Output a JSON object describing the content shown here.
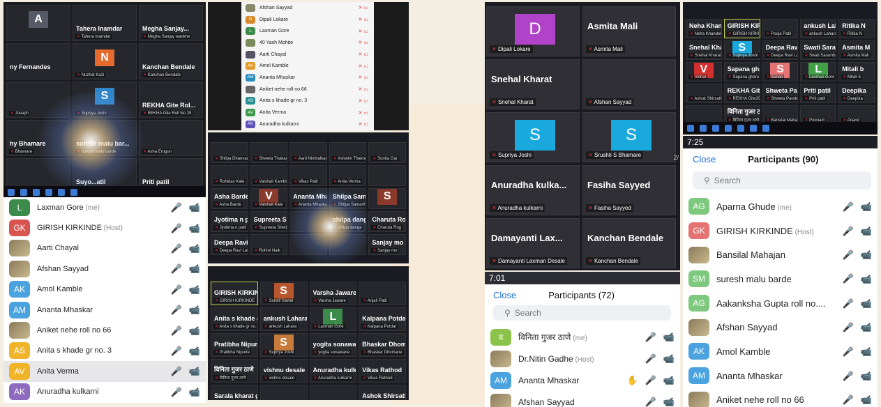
{
  "collage": {
    "shot1": {
      "tiles": [
        {
          "name": "",
          "sub": "",
          "avatar": "A",
          "color": "#555a66"
        },
        {
          "name": "Tahera Inamdar",
          "sub": "Tahera Inamdar"
        },
        {
          "name": "Megha Sanjay...",
          "sub": "Megha Sanjay wankhe"
        },
        {
          "name": "ny Fernandes",
          "sub": ""
        },
        {
          "name": "",
          "sub": "Nuzhat Kazi",
          "avatar": "N",
          "color": "#e46a2e"
        },
        {
          "name": "Kanchan Bendale",
          "sub": "Kanchan Bendale"
        },
        {
          "name": "",
          "sub": "Joseph"
        },
        {
          "name": "",
          "sub": "Supriya Joshi",
          "avatar": "S",
          "color": "#2f86c8"
        },
        {
          "name": "REKHA Gite Rol...",
          "sub": "REKHA Gite Roll No 29"
        },
        {
          "name": "hy Bhamare",
          "sub": "Bhamare"
        },
        {
          "name": "suresh malu bar...",
          "sub": "suresh malu barde"
        },
        {
          "name": "",
          "sub": "Asha Erogun"
        },
        {
          "name": "",
          "sub": "Mohite"
        },
        {
          "name": "Suyo...atil",
          "sub": "Suyog patil"
        },
        {
          "name": "Priti patil",
          "sub": "Priti patil"
        }
      ]
    },
    "shot2": {
      "rows": [
        {
          "name": "Afshan Sayyad",
          "avatar": "",
          "color": "#8a8a6a"
        },
        {
          "name": "Dipali Lokare",
          "avatar": "D",
          "color": "#d58a2a"
        },
        {
          "name": "Laxman Gore",
          "avatar": "L",
          "color": "#3d8b4a"
        },
        {
          "name": "40 Yash Mohite",
          "avatar": "",
          "color": "#7a8a5a"
        },
        {
          "name": "Aarti Chayal",
          "avatar": "",
          "color": "#556"
        },
        {
          "name": "Amol Kamble",
          "avatar": "AK",
          "color": "#e39a25"
        },
        {
          "name": "Ananta Mhaskar",
          "avatar": "AM",
          "color": "#2a8fc0"
        },
        {
          "name": "Aniket nehe roll no 66",
          "avatar": "",
          "color": "#666"
        },
        {
          "name": "Anita s khade gr no. 3",
          "avatar": "AS",
          "color": "#2a8f8f"
        },
        {
          "name": "Anita Verma",
          "avatar": "AV",
          "color": "#3b9b4a"
        },
        {
          "name": "Anuradha kulkarni",
          "avatar": "AK",
          "color": "#5b4fb8"
        }
      ]
    },
    "shot3": {
      "tiles": [
        {
          "name": "",
          "sub": "Shilpa Dhanvade"
        },
        {
          "name": "",
          "sub": "Shweta Thakare"
        },
        {
          "name": "",
          "sub": "Aarti Nimbalkar"
        },
        {
          "name": "",
          "sub": "Ashwini Thakre"
        },
        {
          "name": "",
          "sub": "Sunita Gar"
        },
        {
          "name": "",
          "sub": "Rohidas Kale"
        },
        {
          "name": "",
          "sub": "Vaishali Kamble"
        },
        {
          "name": "",
          "sub": "Vikas Patil"
        },
        {
          "name": "",
          "sub": "Anita Verma"
        },
        {
          "name": "",
          "sub": ""
        },
        {
          "name": "Asha Barde",
          "sub": "Asha Barde"
        },
        {
          "name": "",
          "sub": "Vaishali Kale",
          "avatar": "V",
          "color": "#8a3a2a"
        },
        {
          "name": "Ananta Mhaskar",
          "sub": "Ananta Mhaskar"
        },
        {
          "name": "Shilpa Samarth",
          "sub": "Shilpa Samarth"
        },
        {
          "name": "",
          "sub": "",
          "avatar": "S",
          "color": "#8a3a2a"
        },
        {
          "name": "Jyotima n patil",
          "sub": "Jyotima n patil"
        },
        {
          "name": "Supreeta Shetty",
          "sub": "Supreeta Shetty"
        },
        {
          "name": "",
          "sub": ""
        },
        {
          "name": "shilpa dange",
          "sub": "shilpa dange"
        },
        {
          "name": "Charuta Rog",
          "sub": "Charuta Rog"
        },
        {
          "name": "Deepa Ravi Lal...",
          "sub": "Deepa Ravi Lahari"
        },
        {
          "name": "",
          "sub": "Rohini Naik"
        },
        {
          "name": "",
          "sub": ""
        },
        {
          "name": "",
          "sub": ""
        },
        {
          "name": "Sanjay mo",
          "sub": "Sanjay mo"
        }
      ]
    },
    "shot4": {
      "tiles": [
        {
          "name": "GIRISH KIRKINDE",
          "sub": "GIRISH KIRKINDE",
          "hl": true
        },
        {
          "name": "",
          "sub": "Sonali Sawai",
          "avatar": "S",
          "color": "#b8572e"
        },
        {
          "name": "Varsha Jaware",
          "sub": "Varsha Jaware"
        },
        {
          "name": "",
          "sub": "Anjali Patil"
        },
        {
          "name": "Anita s khade g...",
          "sub": "Anita s khade gr no. 3"
        },
        {
          "name": "ankush Lahara",
          "sub": "ankush Lahara"
        },
        {
          "name": "",
          "sub": "Laxman Gore",
          "avatar": "L",
          "color": "#3d8b4a"
        },
        {
          "name": "Kalpana Potdar",
          "sub": "Kalpana Potdar"
        },
        {
          "name": "Pratibha Nipurte",
          "sub": "Pratibha Nipurte"
        },
        {
          "name": "",
          "sub": "Supriya Joshi",
          "avatar": "S",
          "color": "#c87a3a"
        },
        {
          "name": "yogita sonawane",
          "sub": "yogita sonawane"
        },
        {
          "name": "Bhaskar Dhoma...",
          "sub": "Bhaskar Dhomane"
        },
        {
          "name": "विनिता गुजर ठाणे",
          "sub": "विनिता गुजर ठाणे"
        },
        {
          "name": "vishnu desale",
          "sub": "vishnu desale"
        },
        {
          "name": "Anuradha kulka...",
          "sub": "Anuradha kulkarni"
        },
        {
          "name": "Vikas Rathod",
          "sub": "Vikas Rathod"
        },
        {
          "name": "Sarala kharat gr...",
          "sub": "Sarala kharat group no 3"
        },
        {
          "name": "",
          "sub": "Aniket nehe"
        },
        {
          "name": "",
          "sub": "Aniket nehe roll no 66"
        },
        {
          "name": "Ashok Shirsath",
          "sub": "Ashok Shirsath"
        }
      ]
    },
    "shot5": {
      "rows": [
        {
          "name": "Laxman Gore",
          "tag": "(me)",
          "avatar": "L",
          "color": "#3d8b4a"
        },
        {
          "name": "GIRISH KIRKINDE",
          "tag": "(Host)",
          "avatar": "GK",
          "color": "#d9534f"
        },
        {
          "name": "Aarti Chayal",
          "tag": "",
          "avatar": "",
          "color": ""
        },
        {
          "name": "Afshan Sayyad",
          "tag": "",
          "avatar": "",
          "color": ""
        },
        {
          "name": "Amol Kamble",
          "tag": "",
          "avatar": "AK",
          "color": "#4aa3df"
        },
        {
          "name": "Ananta Mhaskar",
          "tag": "",
          "avatar": "AM",
          "color": "#4aa3df"
        },
        {
          "name": "Aniket nehe roll no 66",
          "tag": "",
          "avatar": "",
          "color": ""
        },
        {
          "name": "Anita s khade gr no. 3",
          "tag": "",
          "avatar": "AS",
          "color": "#f0b429"
        },
        {
          "name": "Anita Verma",
          "tag": "",
          "avatar": "AV",
          "color": "#f0b429",
          "selected": true
        },
        {
          "name": "Anuradha kulkarni",
          "tag": "",
          "avatar": "AK",
          "color": "#8e6bbf"
        }
      ]
    },
    "shot6": {
      "tiles": [
        {
          "name": "",
          "sub": "Dipali Lokare",
          "avatar": "D",
          "color": "#b043c7"
        },
        {
          "name": "Asmita Mali",
          "sub": "Asmita Mali"
        },
        {
          "name": "Snehal Kharat",
          "sub": "Snehal Kharat"
        },
        {
          "name": "",
          "sub": "Afshan Sayyad"
        },
        {
          "name": "",
          "sub": "Supriya Joshi",
          "avatar": "S",
          "color": "#1aa9dc"
        },
        {
          "name": "",
          "sub": "Srushti S Bhamare",
          "avatar": "S",
          "color": "#1aa9dc"
        },
        {
          "name": "Anuradha kulka...",
          "sub": "Anuradha kulkarni"
        },
        {
          "name": "Fasiha Sayyed",
          "sub": "Fasiha Sayyed"
        },
        {
          "name": "Damayanti Lax...",
          "sub": "Damayanti Laxman Desale"
        },
        {
          "name": "Kanchan Bendale",
          "sub": "Kanchan Bendale"
        }
      ],
      "page": "2/"
    },
    "shot7": {
      "time": "7:01",
      "close": "Close",
      "title": "Participants (72)",
      "search": "Search",
      "rows": [
        {
          "name": "विनिता गुजर ठाणे",
          "tag": "(me)",
          "avatar": "व",
          "color": "#8bc34a",
          "icons": [
            "mic-off",
            "cam-off"
          ]
        },
        {
          "name": "Dr.Nitin Gadhe",
          "tag": "(Host)",
          "avatar": "",
          "color": "",
          "icons": [
            "mic-on",
            "cam-off"
          ]
        },
        {
          "name": "Ananta Mhaskar",
          "tag": "",
          "avatar": "AM",
          "color": "#4aa3df",
          "icons": [
            "hand",
            "mic-off",
            "cam-off"
          ]
        },
        {
          "name": "Afshan Sayyad",
          "tag": "",
          "avatar": "",
          "color": "",
          "icons": [
            "mic-gray",
            "cam-off"
          ]
        }
      ]
    },
    "shot8": {
      "tiles": [
        {
          "name": "Neha Khandekar",
          "sub": "Neha Khandekar"
        },
        {
          "name": "GIRISH KIRKINDE",
          "sub": "GIRISH KIRKINDE",
          "hl": true
        },
        {
          "name": "",
          "sub": "Pooja Patil"
        },
        {
          "name": "ankush Lahara",
          "sub": "ankush Lahara"
        },
        {
          "name": "Ritika N",
          "sub": "Ritika N"
        },
        {
          "name": "Snehal Kharat",
          "sub": "Snehal Kharat"
        },
        {
          "name": "",
          "sub": "Supriya Joshi",
          "avatar": "S",
          "color": "#1aa9dc"
        },
        {
          "name": "Deepa Ravi Lal...",
          "sub": "Deepa Ravi Lahari"
        },
        {
          "name": "Swati Sarambal...",
          "sub": "Swati Sarambale"
        },
        {
          "name": "Asmita M",
          "sub": "Asmita Mali"
        },
        {
          "name": "",
          "sub": "Vishal",
          "avatar": "V",
          "color": "#d32f2f"
        },
        {
          "name": "Sapana ghare",
          "sub": "Sapana ghare"
        },
        {
          "name": "",
          "sub": "Sonali",
          "avatar": "S",
          "color": "#e57373"
        },
        {
          "name": "",
          "sub": "Laxman Gore",
          "avatar": "L",
          "color": "#43a047"
        },
        {
          "name": "Mitali b",
          "sub": "Mitali b"
        },
        {
          "name": "",
          "sub": "Ashok Shirsath"
        },
        {
          "name": "REKHA Gite29",
          "sub": "REKHA Gite29"
        },
        {
          "name": "Shweta Pandey",
          "sub": "Shweta Pandey"
        },
        {
          "name": "Priti patil",
          "sub": "Priti patil"
        },
        {
          "name": "Deepika",
          "sub": "Deepika"
        },
        {
          "name": "",
          "sub": ""
        },
        {
          "name": "विनिता गुजर ठाणे",
          "sub": "विनिता गुजर ठाणे"
        },
        {
          "name": "",
          "sub": "Bansilal Mahajan"
        },
        {
          "name": "",
          "sub": "Poonam"
        },
        {
          "name": "",
          "sub": "Anand"
        }
      ]
    },
    "shot9": {
      "time": "7:25",
      "close": "Close",
      "title": "Participants (90)",
      "search": "Search",
      "rows": [
        {
          "name": "Aparna Ghude",
          "tag": "(me)",
          "avatar": "AG",
          "color": "#7fc97f",
          "icons": [
            "mic-off",
            "cam-off"
          ]
        },
        {
          "name": "GIRISH KIRKINDE",
          "tag": "(Host)",
          "avatar": "GK",
          "color": "#e57373",
          "icons": [
            "mic-on",
            "cam-off"
          ]
        },
        {
          "name": "Bansilal Mahajan",
          "tag": "",
          "avatar": "",
          "color": "",
          "icons": [
            "mic-gray",
            "cam-off"
          ]
        },
        {
          "name": "suresh malu barde",
          "tag": "",
          "avatar": "SM",
          "color": "#7fc97f",
          "icons": [
            "mic-gray",
            "cam-off"
          ]
        },
        {
          "name": "Aakanksha Gupta roll no....",
          "tag": "",
          "avatar": "AG",
          "color": "#7fc97f",
          "icons": [
            "mic-off",
            "cam-off"
          ]
        },
        {
          "name": "Afshan Sayyad",
          "tag": "",
          "avatar": "",
          "color": "",
          "icons": [
            "mic-off",
            "cam-off"
          ]
        },
        {
          "name": "Amol Kamble",
          "tag": "",
          "avatar": "AK",
          "color": "#4aa3df",
          "icons": [
            "mic-off",
            "cam-off"
          ]
        },
        {
          "name": "Ananta Mhaskar",
          "tag": "",
          "avatar": "AM",
          "color": "#4aa3df",
          "icons": [
            "mic-off",
            "cam-off"
          ]
        },
        {
          "name": "Aniket nehe roll no 66",
          "tag": "",
          "avatar": "",
          "color": "",
          "icons": [
            "mic-off",
            "cam-off"
          ]
        }
      ]
    }
  },
  "icons": {
    "mic-off": "🎤",
    "mic-on": "🎤",
    "mic-gray": "🎤",
    "cam-off": "📹",
    "hand": "✋"
  }
}
